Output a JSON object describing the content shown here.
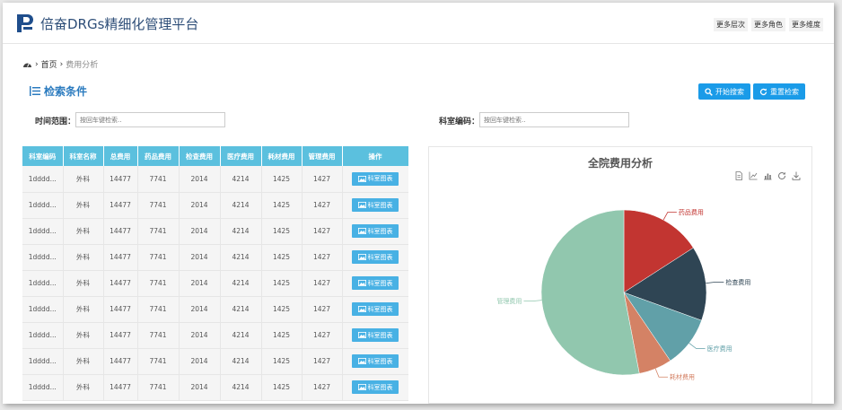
{
  "app": {
    "title": "倍奋DRGs精细化管理平台"
  },
  "top_links": [
    "更多层次",
    "更多角色",
    "更多维度"
  ],
  "breadcrumb": {
    "home": "首页",
    "sep": "›",
    "current": "费用分析"
  },
  "search_section": {
    "title": "检索条件",
    "start_search_label": "开始搜索",
    "reset_label": "重置检索",
    "time_range_label": "时间范围：",
    "time_range_placeholder": "按回车键检索..",
    "dept_code_label": "科室编码：",
    "dept_code_placeholder": "按回车键检索.."
  },
  "table": {
    "headers": [
      "科室编码",
      "科室名称",
      "总费用",
      "药品费用",
      "检查费用",
      "医疗费用",
      "耗材费用",
      "管理费用",
      "操作"
    ],
    "rows": [
      [
        "1dddd...",
        "外科",
        "14477",
        "7741",
        "2014",
        "4214",
        "1425",
        "1427"
      ],
      [
        "1dddd...",
        "外科",
        "14477",
        "7741",
        "2014",
        "4214",
        "1425",
        "1427"
      ],
      [
        "1dddd...",
        "外科",
        "14477",
        "7741",
        "2014",
        "4214",
        "1425",
        "1427"
      ],
      [
        "1dddd...",
        "外科",
        "14477",
        "7741",
        "2014",
        "4214",
        "1425",
        "1427"
      ],
      [
        "1dddd...",
        "外科",
        "14477",
        "7741",
        "2014",
        "4214",
        "1425",
        "1427"
      ],
      [
        "1dddd...",
        "外科",
        "14477",
        "7741",
        "2014",
        "4214",
        "1425",
        "1427"
      ],
      [
        "1dddd...",
        "外科",
        "14477",
        "7741",
        "2014",
        "4214",
        "1425",
        "1427"
      ],
      [
        "1dddd...",
        "外科",
        "14477",
        "7741",
        "2014",
        "4214",
        "1425",
        "1427"
      ],
      [
        "1dddd...",
        "外科",
        "14477",
        "7741",
        "2014",
        "4214",
        "1425",
        "1427"
      ]
    ],
    "action_label": "科室图表"
  },
  "colors": {
    "header_bg": "#5bc0de",
    "primary": "#1a9be8",
    "title_blue": "#2b7bbf"
  },
  "chart_data": {
    "type": "pie",
    "title": "全院费用分析",
    "slices": [
      {
        "name": "药品费用",
        "value": 1590,
        "color": "#c23531"
      },
      {
        "name": "检查费用",
        "value": 1460,
        "color": "#2f4554"
      },
      {
        "name": "医疗费用",
        "value": 1000,
        "color": "#61a0a8"
      },
      {
        "name": "耗材费用",
        "value": 650,
        "color": "#d48265"
      },
      {
        "name": "管理费用",
        "value": 5300,
        "color": "#91c7ae"
      }
    ]
  }
}
